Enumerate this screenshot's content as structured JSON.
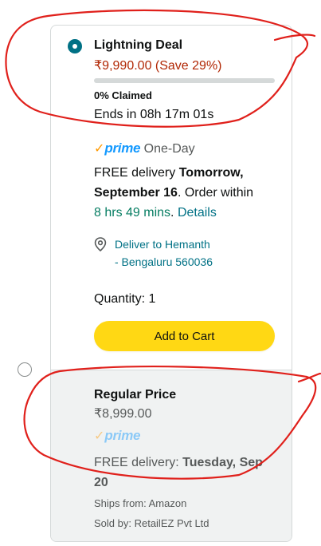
{
  "deal": {
    "title": "Lightning Deal",
    "price_line": "₹9,990.00 (Save 29%)",
    "claimed_percent": 0,
    "claimed_label": "0% Claimed",
    "ends_label": "Ends in 08h 17m 01s",
    "prime_check": "✓",
    "prime_word": "prime",
    "prime_tier": "One-Day",
    "delivery_prefix": "FREE delivery ",
    "delivery_day": "Tomorrow,",
    "delivery_date": "September 16",
    "delivery_suffix": ". Order within",
    "order_within": "8 hrs 49 mins",
    "order_period": ".",
    "details_link": "Details",
    "location_line1": "Deliver to Hemanth",
    "location_line2": "- Bengaluru 560036",
    "quantity_label": "Quantity: 1",
    "add_to_cart_label": "Add to Cart"
  },
  "regular": {
    "title": "Regular Price",
    "price": "₹8,999.00",
    "prime_check": "✓",
    "prime_word": "prime",
    "delivery_prefix": "FREE delivery: ",
    "delivery_date_a": "Tuesday, Sep",
    "delivery_date_b": "20",
    "ships_from": "Ships from: Amazon",
    "sold_by": "Sold by: RetailEZ Pvt Ltd"
  },
  "colors": {
    "accent_teal": "#007185",
    "price_red": "#b12704",
    "button_yellow": "#ffd814",
    "prime_blue": "#1399ff",
    "green": "#067d62",
    "annotation_red": "#e0201b"
  }
}
